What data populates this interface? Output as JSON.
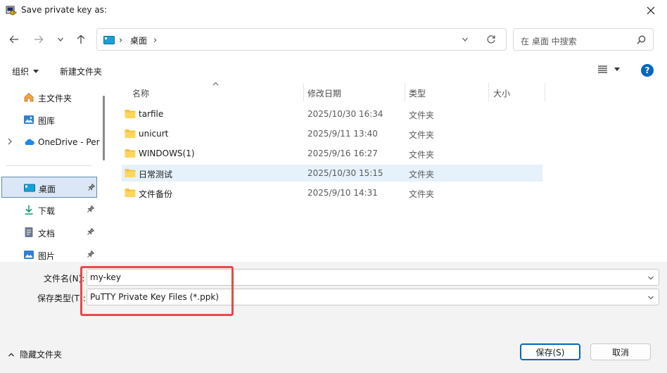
{
  "window": {
    "title": "Save private key as:"
  },
  "address": {
    "crumb": "桌面",
    "separator": "›"
  },
  "search": {
    "placeholder": "在 桌面 中搜索"
  },
  "toolbar": {
    "organize": "组织",
    "new_folder": "新建文件夹",
    "help": "?"
  },
  "sidebar": {
    "items": [
      {
        "label": "主文件夹",
        "icon": "home-icon"
      },
      {
        "label": "图库",
        "icon": "gallery-icon"
      },
      {
        "label": "OneDrive - Per",
        "icon": "cloud-icon"
      },
      {
        "label": "桌面",
        "icon": "desktop-icon",
        "selected": true
      },
      {
        "label": "下载",
        "icon": "download-icon"
      },
      {
        "label": "文档",
        "icon": "document-icon"
      },
      {
        "label": "图片",
        "icon": "picture-icon"
      }
    ]
  },
  "columns": {
    "name": "名称",
    "date": "修改日期",
    "type": "类型",
    "size": "大小"
  },
  "files": [
    {
      "name": "tarfile",
      "date": "2025/10/30 16:34",
      "type": "文件夹"
    },
    {
      "name": "unicurt",
      "date": "2025/9/11 13:40",
      "type": "文件夹"
    },
    {
      "name": "WINDOWS(1)",
      "date": "2025/9/16 16:27",
      "type": "文件夹"
    },
    {
      "name": "日常测试",
      "date": "2025/10/30 15:15",
      "type": "文件夹",
      "selected": true
    },
    {
      "name": "文件备份",
      "date": "2025/9/10 14:31",
      "type": "文件夹"
    }
  ],
  "form": {
    "filename_label": "文件名(N):",
    "filename_value": "my-key",
    "filetype_label": "保存类型(T):",
    "filetype_value": "PuTTY Private Key Files (*.ppk)"
  },
  "footer": {
    "hide_folders": "隐藏文件夹",
    "save": "保存(S)",
    "cancel": "取消"
  },
  "colors": {
    "accent": "#0067c0",
    "highlight": "#e64a4a",
    "folder": "#f3c33b",
    "selection": "#e5f1fb"
  }
}
